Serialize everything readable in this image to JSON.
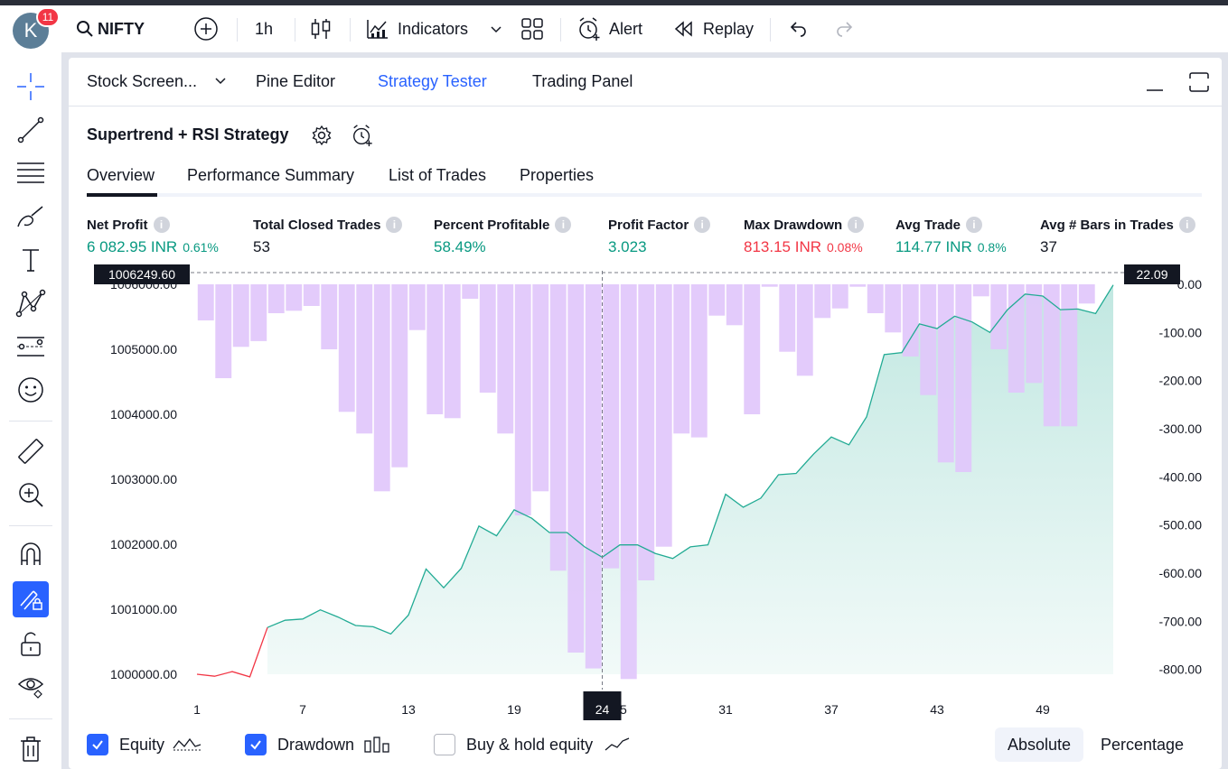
{
  "topbar": {
    "avatar_letter": "K",
    "notification_count": "11",
    "symbol": "NIFTY",
    "interval": "1h",
    "indicators_label": "Indicators",
    "alert_label": "Alert",
    "replay_label": "Replay"
  },
  "panel": {
    "tabs": [
      {
        "label": "Stock Screen...",
        "active": false
      },
      {
        "label": "Pine Editor",
        "active": false
      },
      {
        "label": "Strategy Tester",
        "active": true
      },
      {
        "label": "Trading Panel",
        "active": false
      }
    ],
    "strategy_name": "Supertrend + RSI Strategy",
    "subtabs": [
      "Overview",
      "Performance Summary",
      "List of Trades",
      "Properties"
    ],
    "active_subtab": "Overview"
  },
  "metrics": {
    "net_profit": {
      "label": "Net Profit",
      "value": "6 082.95 INR",
      "pct": "0.61%"
    },
    "total_closed_trades": {
      "label": "Total Closed Trades",
      "value": "53"
    },
    "percent_profitable": {
      "label": "Percent Profitable",
      "value": "58.49%"
    },
    "profit_factor": {
      "label": "Profit Factor",
      "value": "3.023"
    },
    "max_drawdown": {
      "label": "Max Drawdown",
      "value": "813.15 INR",
      "pct": "0.08%"
    },
    "avg_trade": {
      "label": "Avg Trade",
      "value": "114.77 INR",
      "pct": "0.8%"
    },
    "avg_bars": {
      "label": "Avg # Bars in Trades",
      "value": "37"
    }
  },
  "colors": {
    "accent": "#2962ff",
    "profit": "#089981",
    "loss": "#f23645",
    "equity_line": "#22ab94",
    "drawdown_bar": "#e1c7fb"
  },
  "chart_data": {
    "type": "area",
    "x": [
      1,
      2,
      3,
      4,
      5,
      6,
      7,
      8,
      9,
      10,
      11,
      12,
      13,
      14,
      15,
      16,
      17,
      18,
      19,
      20,
      21,
      22,
      23,
      24,
      25,
      26,
      27,
      28,
      29,
      30,
      31,
      32,
      33,
      34,
      35,
      36,
      37,
      38,
      39,
      40,
      41,
      42,
      43,
      44,
      45,
      46,
      47,
      48,
      49,
      50,
      51,
      52,
      53
    ],
    "xticks": [
      "1",
      "7",
      "13",
      "19",
      "24",
      "25",
      "31",
      "37",
      "43",
      "49"
    ],
    "crosshair_x_label": "24",
    "left_axis": {
      "ticks": [
        "1006000.00",
        "1005000.00",
        "1004000.00",
        "1003000.00",
        "1002000.00",
        "1001000.00",
        "1000000.00"
      ],
      "ylim": [
        1000000,
        1006000
      ],
      "crosshair_label": "1006249.60"
    },
    "right_axis": {
      "ticks": [
        "0.00",
        "-100.00",
        "-200.00",
        "-300.00",
        "-400.00",
        "-500.00",
        "-600.00",
        "-700.00",
        "-800.00"
      ],
      "ylim": [
        -810,
        0
      ],
      "crosshair_label": "22.09"
    },
    "series": [
      {
        "name": "Equity",
        "type": "line",
        "axis": "left",
        "values": [
          1000000,
          999970,
          1000040,
          999960,
          1000720,
          1000830,
          1000850,
          1000990,
          1000880,
          1000750,
          1000730,
          1000620,
          1000910,
          1001620,
          1001330,
          1001630,
          1002280,
          1002130,
          1002530,
          1002400,
          1002180,
          1002180,
          1001960,
          1001800,
          1001990,
          1001990,
          1001860,
          1001780,
          1001960,
          1001990,
          1002770,
          1002570,
          1002710,
          1003070,
          1003090,
          1003390,
          1003650,
          1003530,
          1003960,
          1004920,
          1004950,
          1005390,
          1005320,
          1005510,
          1005420,
          1005260,
          1005610,
          1005850,
          1005820,
          1005610,
          1005620,
          1005550,
          1005990,
          1006010
        ]
      },
      {
        "name": "Drawdown",
        "type": "bar",
        "axis": "right",
        "values": [
          -75,
          -195,
          -130,
          -118,
          -60,
          -55,
          -45,
          -135,
          -265,
          -310,
          -430,
          -380,
          -95,
          -270,
          -278,
          -30,
          -225,
          -310,
          -480,
          -430,
          -595,
          -765,
          -798,
          -590,
          -820,
          -615,
          -545,
          -310,
          -318,
          -65,
          -85,
          -270,
          -5,
          -140,
          -190,
          -70,
          -50,
          -5,
          -60,
          -100,
          -150,
          -230,
          -370,
          -390,
          -25,
          -135,
          -225,
          -205,
          -295,
          -295,
          -40
        ]
      },
      {
        "name": "Buy & hold equity",
        "visible": false,
        "values": []
      }
    ]
  },
  "legend": {
    "equity_label": "Equity",
    "drawdown_label": "Drawdown",
    "buyhold_label": "Buy & hold equity",
    "absolute_label": "Absolute",
    "percentage_label": "Percentage"
  }
}
